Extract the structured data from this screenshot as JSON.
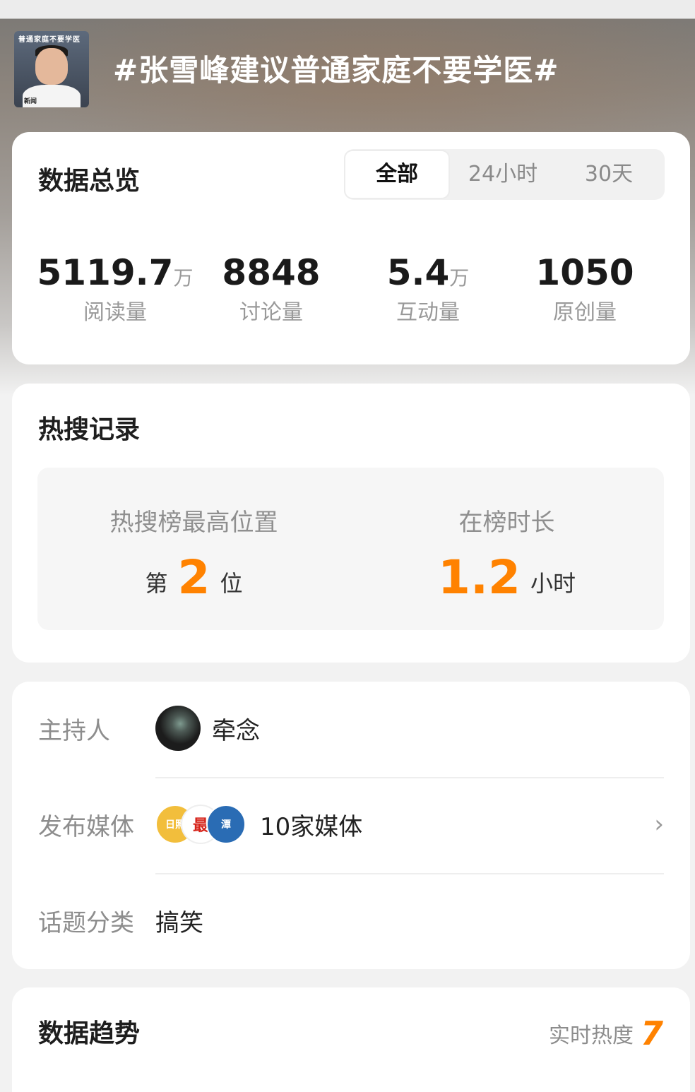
{
  "header": {
    "thumbnail_caption": "普通家庭不要学医",
    "thumbnail_subcaption": "新闻",
    "topic": "#张雪峰建议普通家庭不要学医#"
  },
  "overview": {
    "title": "数据总览",
    "tabs": [
      {
        "label": "全部",
        "active": true
      },
      {
        "label": "24小时",
        "active": false
      },
      {
        "label": "30天",
        "active": false
      }
    ],
    "stats": [
      {
        "value": "5119.7",
        "unit": "万",
        "label": "阅读量"
      },
      {
        "value": "8848",
        "unit": "",
        "label": "讨论量"
      },
      {
        "value": "5.4",
        "unit": "万",
        "label": "互动量"
      },
      {
        "value": "1050",
        "unit": "",
        "label": "原创量"
      }
    ]
  },
  "hot_search": {
    "title": "热搜记录",
    "peak_label": "热搜榜最高位置",
    "peak_prefix": "第",
    "peak_value": "2",
    "peak_suffix": "位",
    "duration_label": "在榜时长",
    "duration_value": "1.2",
    "duration_unit": "小时"
  },
  "info": {
    "host_label": "主持人",
    "host_name": "牵念",
    "media_label": "发布媒体",
    "media_logos": [
      "日照",
      "最",
      "潭"
    ],
    "media_count": "10家媒体",
    "category_label": "话题分类",
    "category_value": "搞笑"
  },
  "trend": {
    "title": "数据趋势",
    "realtime_label": "实时热度",
    "realtime_value": "7"
  },
  "colors": {
    "accent": "#ff8200",
    "card_bg": "#ffffff",
    "page_bg": "#f2f2f2"
  }
}
